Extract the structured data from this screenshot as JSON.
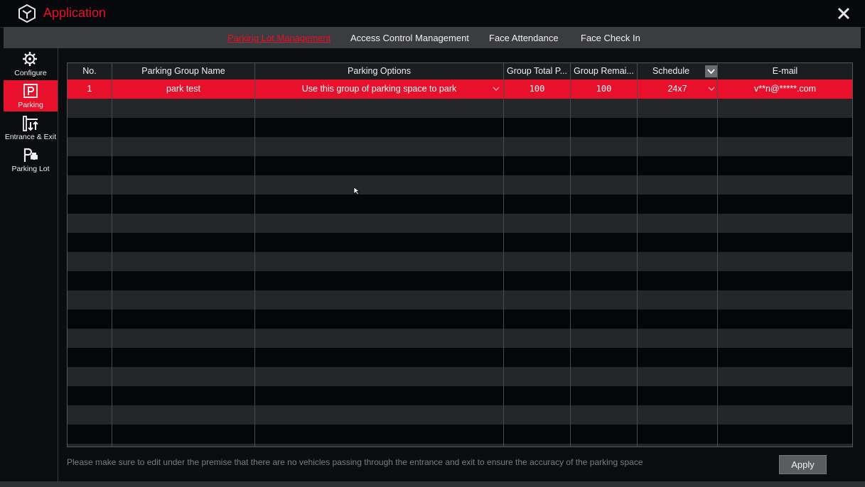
{
  "app": {
    "title": "Application",
    "logo_icon": "cube-icon",
    "close_icon": "close-icon",
    "accent_color": "#e8102a"
  },
  "tabs": [
    {
      "label": "Parking Lot Management",
      "active": true
    },
    {
      "label": "Access Control Management",
      "active": false
    },
    {
      "label": "Face Attendance",
      "active": false
    },
    {
      "label": "Face Check In",
      "active": false
    }
  ],
  "sidebar": {
    "items": [
      {
        "label": "Configure",
        "icon": "gear-icon",
        "active": false
      },
      {
        "label": "Parking",
        "icon": "parking-icon",
        "active": true
      },
      {
        "label": "Entrance & Exit",
        "icon": "entrance-exit-icon",
        "active": false
      },
      {
        "label": "Parking Lot",
        "icon": "parking-lot-icon",
        "active": false
      }
    ]
  },
  "table": {
    "columns": [
      "No.",
      "Parking Group Name",
      "Parking Options",
      "Group Total P...",
      "Group Remai...",
      "Schedule",
      "E-mail"
    ],
    "rows": [
      {
        "no": "1",
        "name": "park test",
        "option": "Use this group of parking space to park",
        "total": "100",
        "remaining": "100",
        "schedule": "24x7",
        "email": "v**n@*****.com",
        "selected": true
      }
    ]
  },
  "footer": {
    "note": "Please make sure to edit under the premise that there are no vehicles passing through the entrance and exit to ensure the accuracy of the parking space",
    "apply_label": "Apply"
  }
}
